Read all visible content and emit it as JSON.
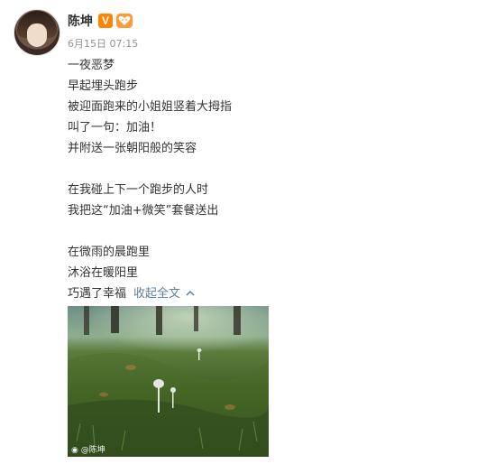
{
  "post": {
    "author": "陈坤",
    "meta": "6月15日 07:15",
    "lines": [
      "一夜恶梦",
      "早起埋头跑步",
      "被迎面跑来的小姐姐竖着大拇指",
      "叫了一句：加油！",
      "并附送一张朝阳般的笑容",
      "",
      "在我碰上下一个跑步的人时",
      "我把这“加油+微笑”套餐送出",
      "",
      "在微雨的晨跑里",
      "沐浴在暖阳里",
      "巧遇了幸福"
    ],
    "collapse_label": "收起全文",
    "image": {
      "watermark": "@陈坤"
    }
  },
  "badges": {
    "verified_label": "V"
  },
  "icons": {
    "verified": "verified-v-icon",
    "fans": "fans-heart-icon",
    "collapse": "chevron-up-icon",
    "weibo": "weibo-logo-icon"
  },
  "colors": {
    "link": "#5c7f9c",
    "verified": "#ff8200",
    "meta": "#939393"
  }
}
